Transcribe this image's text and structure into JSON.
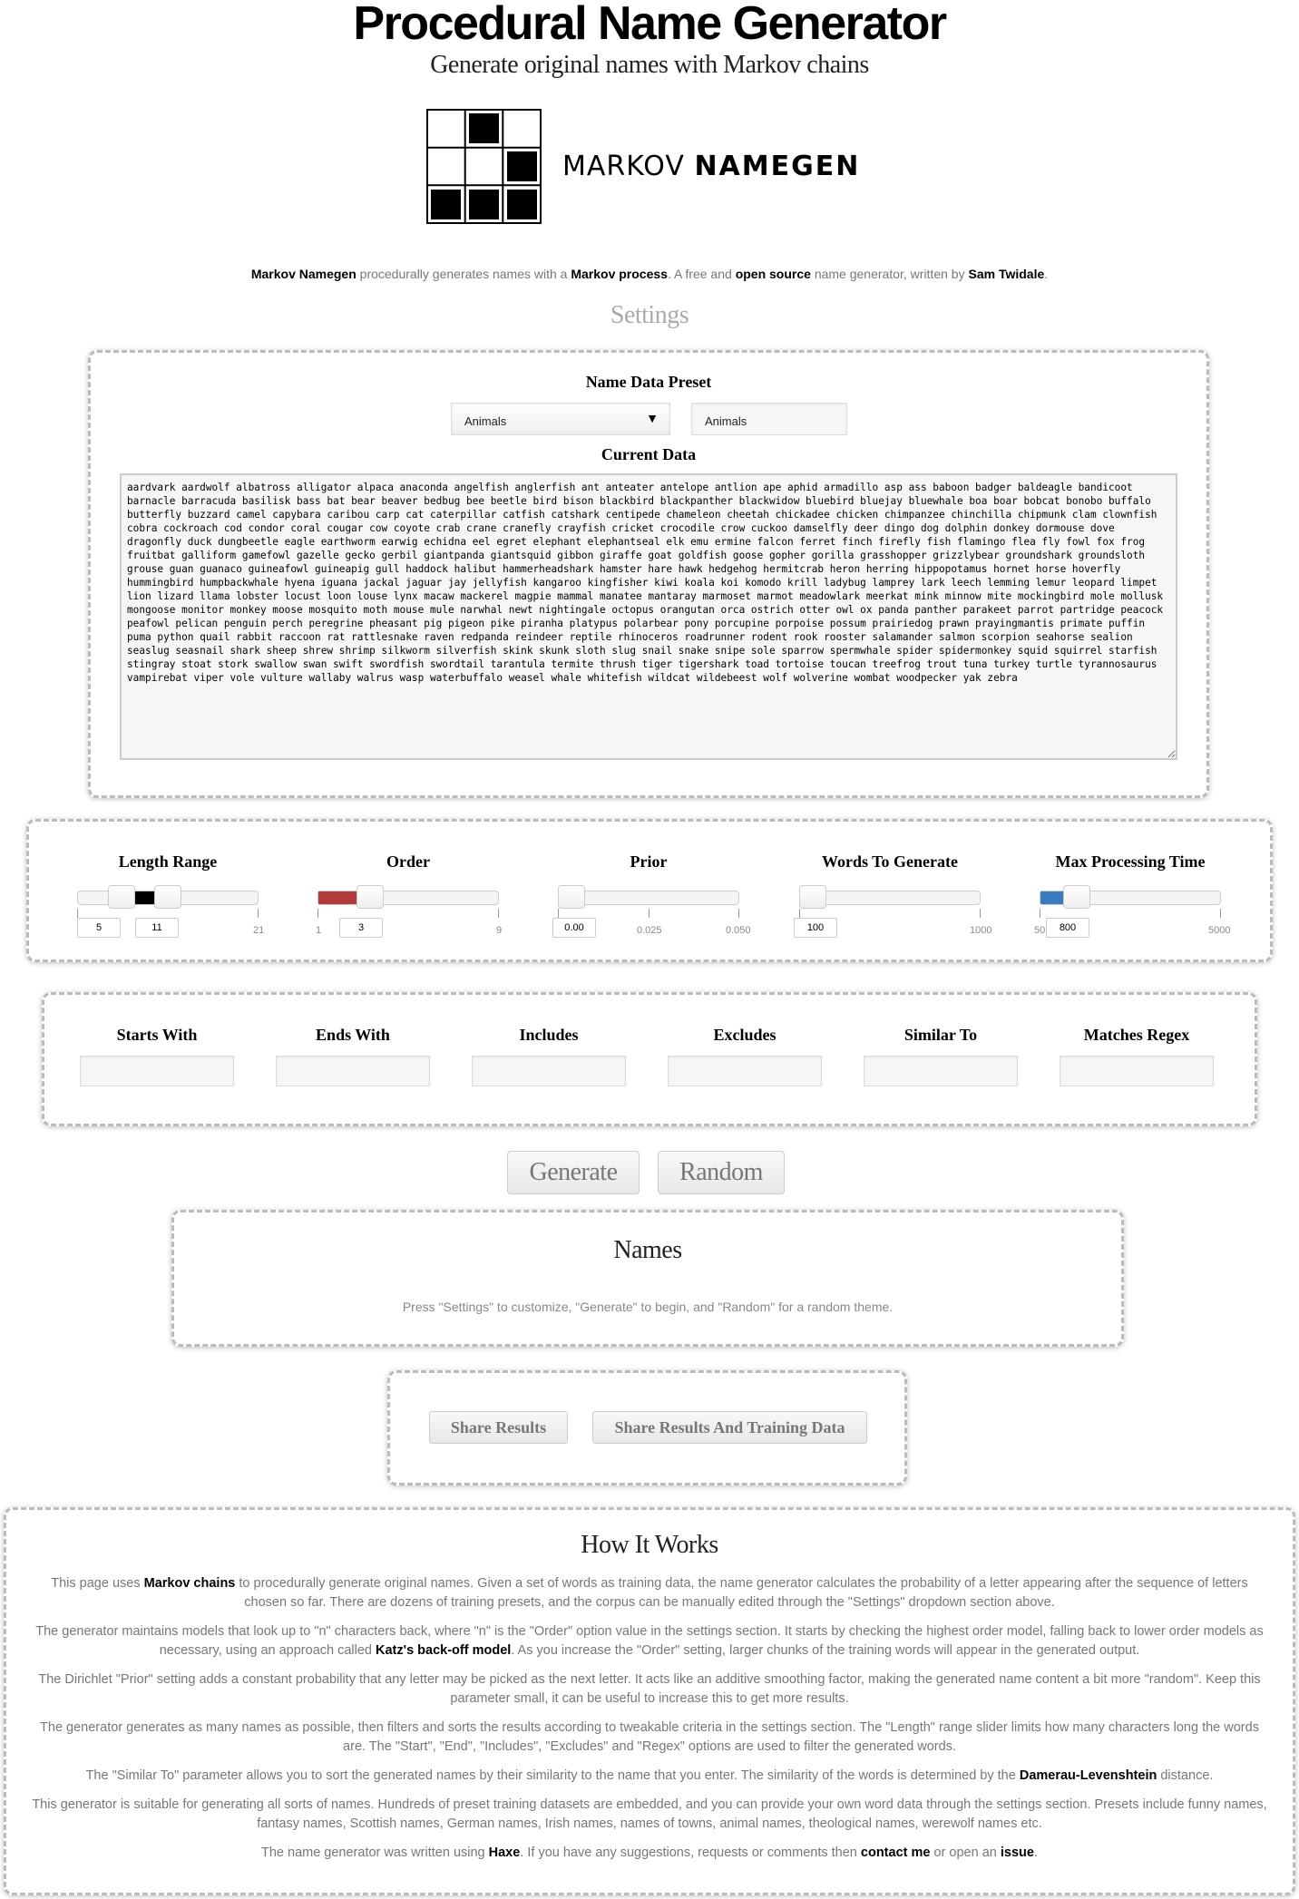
{
  "header": {
    "title": "Procedural Name Generator",
    "subtitle": "Generate original names with Markov chains",
    "logo_text_light": "MARKOV",
    "logo_text_bold": "NAMEGEN"
  },
  "intro": {
    "link_app": "Markov Namegen",
    "text1": " procedurally generates names with a ",
    "link_process": "Markov process",
    "text2": ". A free and ",
    "link_open": "open source",
    "text3": " name generator, written by ",
    "link_author": "Sam Twidale",
    "text4": "."
  },
  "settings": {
    "heading": "Settings",
    "preset_label": "Name Data Preset",
    "preset_selected": "Animals",
    "preset_name_value": "Animals",
    "current_data_label": "Current Data",
    "current_data": "aardvark aardwolf albatross alligator alpaca anaconda angelfish anglerfish ant anteater antelope antlion ape aphid armadillo asp ass baboon badger baldeagle bandicoot barnacle barracuda basilisk bass bat bear beaver bedbug bee beetle bird bison blackbird blackpanther blackwidow bluebird bluejay bluewhale boa boar bobcat bonobo buffalo butterfly buzzard camel capybara caribou carp cat caterpillar catfish catshark centipede chameleon cheetah chickadee chicken chimpanzee chinchilla chipmunk clam clownfish cobra cockroach cod condor coral cougar cow coyote crab crane cranefly crayfish cricket crocodile crow cuckoo damselfly deer dingo dog dolphin donkey dormouse dove dragonfly duck dungbeetle eagle earthworm earwig echidna eel egret elephant elephantseal elk emu ermine falcon ferret finch firefly fish flamingo flea fly fowl fox frog fruitbat galliform gamefowl gazelle gecko gerbil giantpanda giantsquid gibbon giraffe goat goldfish goose gopher gorilla grasshopper grizzlybear groundshark groundsloth grouse guan guanaco guineafowl guineapig gull haddock halibut hammerheadshark hamster hare hawk hedgehog hermitcrab heron herring hippopotamus hornet horse hoverfly hummingbird humpbackwhale hyena iguana jackal jaguar jay jellyfish kangaroo kingfisher kiwi koala koi komodo krill ladybug lamprey lark leech lemming lemur leopard limpet lion lizard llama lobster locust loon louse lynx macaw mackerel magpie mammal manatee mantaray marmoset marmot meadowlark meerkat mink minnow mite mockingbird mole mollusk mongoose monitor monkey moose mosquito moth mouse mule narwhal newt nightingale octopus orangutan orca ostrich otter owl ox panda panther parakeet parrot partridge peacock peafowl pelican penguin perch peregrine pheasant pig pigeon pike piranha platypus polarbear pony porcupine porpoise possum prairiedog prawn prayingmantis primate puffin puma python quail rabbit raccoon rat rattlesnake raven redpanda reindeer reptile rhinoceros roadrunner rodent rook rooster salamander salmon scorpion seahorse sealion seaslug seasnail shark sheep shrew shrimp silkworm silverfish skink skunk sloth slug snail snake snipe sole sparrow spermwhale spider spidermonkey squid squirrel starfish stingray stoat stork swallow swan swift swordfish swordtail tarantula termite thrush tiger tigershark toad tortoise toucan treefrog trout tuna turkey turtle tyrannosaurus vampirebat viper vole vulture wallaby walrus wasp waterbuffalo weasel whale whitefish wildcat wildebeest wolf wolverine wombat woodpecker yak zebra"
  },
  "sliders": {
    "length": {
      "label": "Length Range",
      "min": 1,
      "max": 21,
      "low": 5,
      "high": 11,
      "tick_max": "21",
      "low_text": "5",
      "high_text": "11",
      "color": "#000000"
    },
    "order": {
      "label": "Order",
      "min": 1,
      "max": 9,
      "value": 3,
      "tick_min": "1",
      "tick_max": "9",
      "value_text": "3",
      "color": "#b33a3a"
    },
    "prior": {
      "label": "Prior",
      "min": 0,
      "max": 0.05,
      "value": 0,
      "tick_mid": "0.025",
      "tick_max": "0.050",
      "value_text": "0.00"
    },
    "words": {
      "label": "Words To Generate",
      "min": 100,
      "max": 1000,
      "value": 100,
      "tick_max": "1000",
      "value_text": "100"
    },
    "time": {
      "label": "Max Processing Time",
      "min": 50,
      "max": 5000,
      "value": 800,
      "tick_min": "50",
      "tick_max": "5000",
      "value_text": "800",
      "color": "#3a7bbf"
    }
  },
  "filters": {
    "starts_with": "Starts With",
    "ends_with": "Ends With",
    "includes": "Includes",
    "excludes": "Excludes",
    "similar_to": "Similar To",
    "matches_regex": "Matches Regex"
  },
  "actions": {
    "generate": "Generate",
    "random": "Random"
  },
  "names": {
    "heading": "Names",
    "hint": "Press \"Settings\" to customize, \"Generate\" to begin, and \"Random\" for a random theme."
  },
  "share": {
    "results": "Share Results",
    "results_and_data": "Share Results And Training Data"
  },
  "how": {
    "heading": "How It Works",
    "p1a": "This page uses ",
    "p1_link": "Markov chains",
    "p1b": " to procedurally generate original names. Given a set of words as training data, the name generator calculates the probability of a letter appearing after the sequence of letters chosen so far. There are dozens of training presets, and the corpus can be manually edited through the \"Settings\" dropdown section above.",
    "p2a": "The generator maintains models that look up to \"n\" characters back, where \"n\" is the \"Order\" option value in the settings section. It starts by checking the highest order model, falling back to lower order models as necessary, using an approach called ",
    "p2_link": "Katz's back-off model",
    "p2b": ". As you increase the \"Order\" setting, larger chunks of the training words will appear in the generated output.",
    "p3": "The Dirichlet \"Prior\" setting adds a constant probability that any letter may be picked as the next letter. It acts like an additive smoothing factor, making the generated name content a bit more \"random\". Keep this parameter small, it can be useful to increase this to get more results.",
    "p4": "The generator generates as many names as possible, then filters and sorts the results according to tweakable criteria in the settings section. The \"Length\" range slider limits how many characters long the words are. The \"Start\", \"End\", \"Includes\", \"Excludes\" and \"Regex\" options are used to filter the generated words.",
    "p5a": "The \"Similar To\" parameter allows you to sort the generated names by their similarity to the name that you enter. The similarity of the words is determined by the ",
    "p5_link": "Damerau-Levenshtein",
    "p5b": " distance.",
    "p6": "This generator is suitable for generating all sorts of names. Hundreds of preset training datasets are embedded, and you can provide your own word data through the settings section. Presets include funny names, fantasy names, Scottish names, German names, Irish names, names of towns, animal names, theological names, werewolf names etc.",
    "p7a": "The name generator was written using ",
    "p7_link1": "Haxe",
    "p7b": ". If you have any suggestions, requests or comments then ",
    "p7_link2": "contact me",
    "p7c": " or open an ",
    "p7_link3": "issue",
    "p7d": "."
  }
}
